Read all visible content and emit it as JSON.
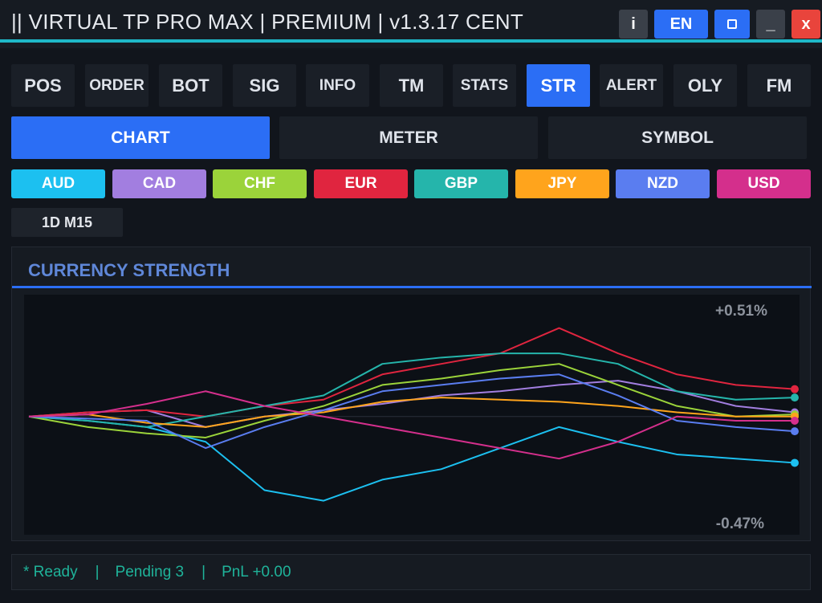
{
  "window": {
    "title": "|| VIRTUAL TP PRO MAX | PREMIUM | v1.3.17  CENT",
    "info_label": "i",
    "lang_label": "EN",
    "min_label": "_",
    "close_label": "x",
    "accent_color": "#1fb8c8"
  },
  "tabs": [
    {
      "label": "POS"
    },
    {
      "label": "ORDER"
    },
    {
      "label": "BOT"
    },
    {
      "label": "SIG"
    },
    {
      "label": "INFO"
    },
    {
      "label": "TM"
    },
    {
      "label": "STATS"
    },
    {
      "label": "STR",
      "active": true
    },
    {
      "label": "ALERT"
    },
    {
      "label": "OLY"
    },
    {
      "label": "FM"
    }
  ],
  "modes": [
    {
      "label": "CHART",
      "active": true
    },
    {
      "label": "METER"
    },
    {
      "label": "SYMBOL"
    }
  ],
  "currencies": [
    {
      "label": "AUD",
      "color": "#1cc0f0"
    },
    {
      "label": "CAD",
      "color": "#a27ee0"
    },
    {
      "label": "CHF",
      "color": "#9bd33a"
    },
    {
      "label": "EUR",
      "color": "#e0253f"
    },
    {
      "label": "GBP",
      "color": "#25b5ab"
    },
    {
      "label": "JPY",
      "color": "#ffa41c"
    },
    {
      "label": "NZD",
      "color": "#5a7df0"
    },
    {
      "label": "USD",
      "color": "#d42f8c"
    }
  ],
  "timeframe": {
    "label": "1D M15"
  },
  "chart_panel": {
    "title": "CURRENCY STRENGTH"
  },
  "chart_data": {
    "type": "line",
    "max_label": "+0.51%",
    "min_label": "-0.47%",
    "ylim": [
      -0.47,
      0.51
    ],
    "series": [
      {
        "name": "AUD",
        "color": "#1cc0f0",
        "values": [
          0,
          -0.02,
          -0.05,
          -0.12,
          -0.35,
          -0.4,
          -0.3,
          -0.25,
          -0.15,
          -0.05,
          -0.12,
          -0.18,
          -0.2,
          -0.22
        ]
      },
      {
        "name": "CAD",
        "color": "#a27ee0",
        "values": [
          0,
          0.02,
          0.03,
          -0.05,
          0.0,
          0.03,
          0.06,
          0.1,
          0.12,
          0.15,
          0.17,
          0.12,
          0.05,
          0.02
        ]
      },
      {
        "name": "CHF",
        "color": "#9bd33a",
        "values": [
          0,
          -0.05,
          -0.08,
          -0.1,
          -0.02,
          0.05,
          0.15,
          0.18,
          0.22,
          0.25,
          0.15,
          0.05,
          0.0,
          0.01
        ]
      },
      {
        "name": "EUR",
        "color": "#e0253f",
        "values": [
          0,
          0.02,
          0.03,
          0.0,
          0.05,
          0.08,
          0.2,
          0.25,
          0.3,
          0.42,
          0.3,
          0.2,
          0.15,
          0.13
        ]
      },
      {
        "name": "GBP",
        "color": "#25b5ab",
        "values": [
          0,
          -0.02,
          -0.05,
          0.0,
          0.05,
          0.1,
          0.25,
          0.28,
          0.3,
          0.3,
          0.25,
          0.12,
          0.08,
          0.09
        ]
      },
      {
        "name": "JPY",
        "color": "#ffa41c",
        "values": [
          0,
          0.01,
          -0.03,
          -0.05,
          0.0,
          0.02,
          0.07,
          0.09,
          0.08,
          0.07,
          0.05,
          0.02,
          0.0,
          0.0
        ]
      },
      {
        "name": "NZD",
        "color": "#5a7df0",
        "values": [
          0,
          -0.01,
          -0.02,
          -0.15,
          -0.05,
          0.03,
          0.12,
          0.15,
          0.18,
          0.2,
          0.1,
          -0.02,
          -0.05,
          -0.07
        ]
      },
      {
        "name": "USD",
        "color": "#d42f8c",
        "values": [
          0,
          0.01,
          0.06,
          0.12,
          0.05,
          0.0,
          -0.05,
          -0.1,
          -0.15,
          -0.2,
          -0.12,
          0.0,
          -0.02,
          -0.02
        ]
      }
    ]
  },
  "status": {
    "ready": "* Ready",
    "sep": "|",
    "pending": "Pending 3",
    "pnl": "PnL +0.00"
  }
}
